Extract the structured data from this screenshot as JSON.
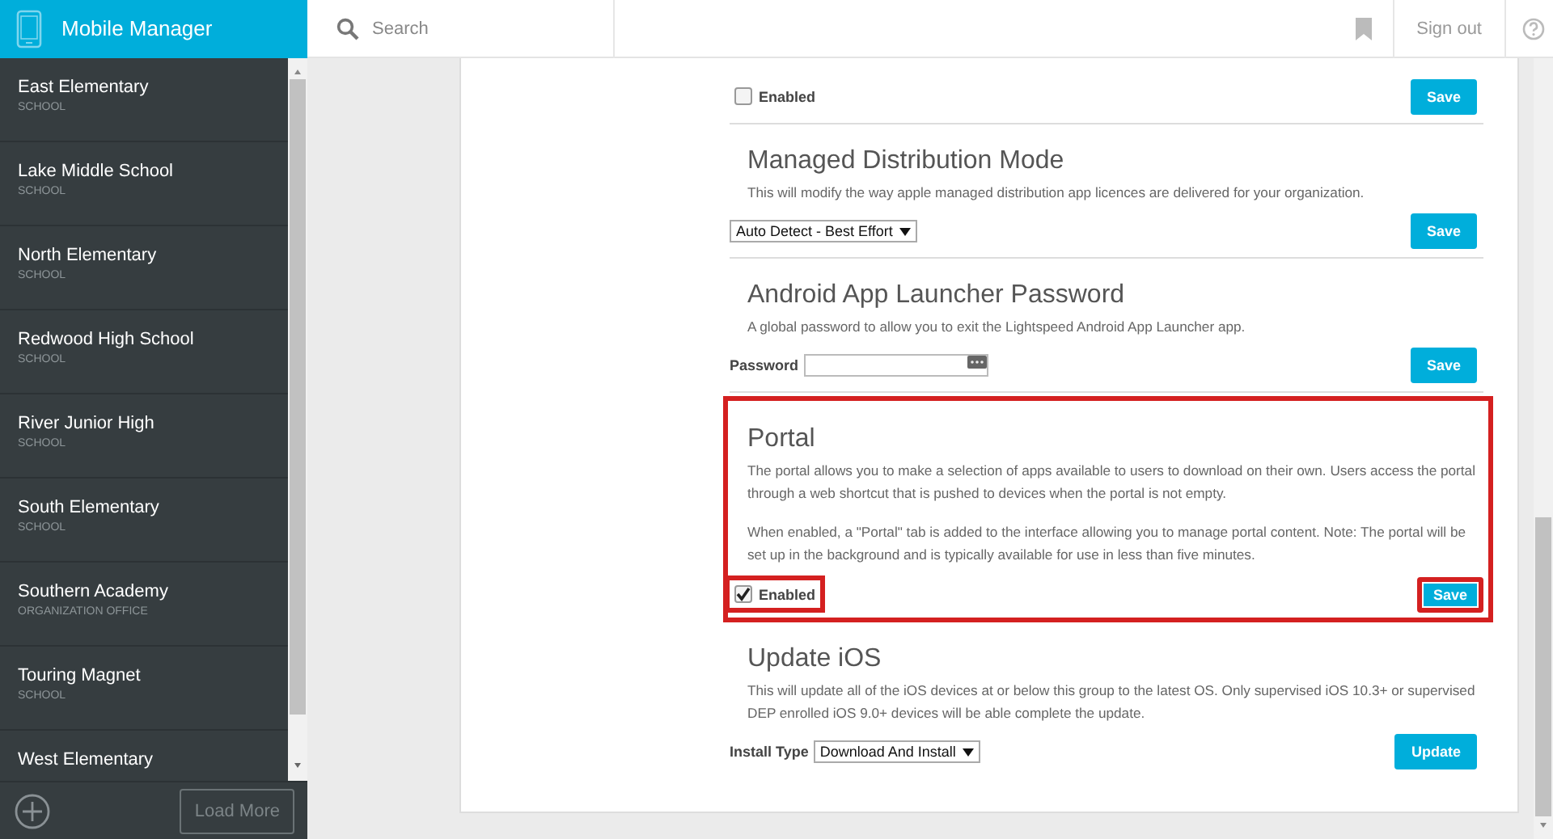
{
  "header": {
    "app_title": "Mobile Manager",
    "search": {
      "placeholder": "Search"
    },
    "sign_out": "Sign out"
  },
  "sidebar": {
    "items": [
      {
        "name": "East Elementary",
        "type": "SCHOOL",
        "selected": false
      },
      {
        "name": "Lake Middle School",
        "type": "SCHOOL",
        "selected": false
      },
      {
        "name": "North Elementary",
        "type": "SCHOOL",
        "selected": false
      },
      {
        "name": "Redwood High School",
        "type": "SCHOOL",
        "selected": false
      },
      {
        "name": "River Junior High",
        "type": "SCHOOL",
        "selected": false
      },
      {
        "name": "South Elementary",
        "type": "SCHOOL",
        "selected": false
      },
      {
        "name": "Southern Academy",
        "type": "ORGANIZATION OFFICE",
        "selected": false
      },
      {
        "name": "Touring Magnet",
        "type": "SCHOOL",
        "selected": false
      },
      {
        "name": "West Elementary",
        "selected": false
      }
    ],
    "load_more": "Load More"
  },
  "sections": [
    {
      "kind": "checkbox",
      "highlighted": false,
      "checkbox": {
        "label": "Enabled",
        "checked": false,
        "highlighted": false
      },
      "button": {
        "label": "Save",
        "highlighted": false
      }
    },
    {
      "kind": "select",
      "highlighted": false,
      "title": "Managed Distribution Mode",
      "description": [
        "This will modify the way apple managed distribution app licences are delivered for your organization."
      ],
      "select": {
        "value": "Auto Detect - Best Effort"
      },
      "button": {
        "label": "Save",
        "highlighted": false
      }
    },
    {
      "kind": "password",
      "highlighted": false,
      "title": "Android App Launcher Password",
      "description": [
        "A global password to allow you to exit the Lightspeed Android App Launcher app."
      ],
      "field": {
        "label": "Password"
      },
      "button": {
        "label": "Save",
        "highlighted": false
      }
    },
    {
      "kind": "checkbox",
      "highlighted": true,
      "title": "Portal",
      "description": [
        "The portal allows you to make a selection of apps available to users to download on their own. Users access the portal through a web shortcut that is pushed to devices when the portal is not empty.",
        "When enabled, a \"Portal\" tab is added to the interface allowing you to manage portal content. Note: The portal will be set up in the background and is typically available for use in less than five minutes."
      ],
      "checkbox": {
        "label": "Enabled",
        "checked": true,
        "highlighted": true
      },
      "button": {
        "label": "Save",
        "highlighted": true
      }
    },
    {
      "kind": "select",
      "highlighted": false,
      "title": "Update iOS",
      "description": [
        "This will update all of the iOS devices at or below this group to the latest OS. Only supervised iOS 10.3+ or supervised DEP enrolled iOS 9.0+ devices will be able complete the update."
      ],
      "select": {
        "label": "Install Type",
        "value": "Download And Install"
      },
      "button": {
        "label": "Update",
        "highlighted": false
      }
    }
  ]
}
